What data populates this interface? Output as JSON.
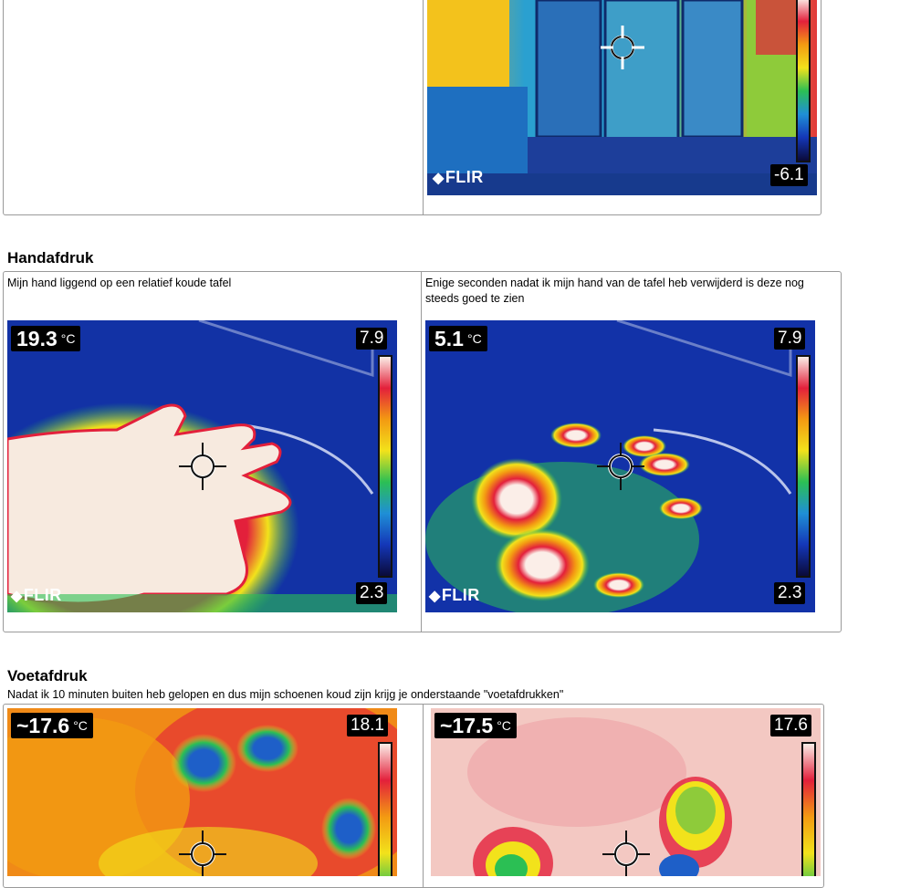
{
  "top_image": {
    "scale_min": "-6.1",
    "logo": "FLIR"
  },
  "hand": {
    "title": "Handafdruk",
    "left_caption": "Mijn hand liggend op een relatief koude tafel",
    "right_caption": "Enige seconden nadat ik mijn hand van de tafel heb verwijderd is deze nog steeds goed te zien",
    "left_image": {
      "temp": "19.3",
      "unit": "°C",
      "scale_max": "7.9",
      "scale_min": "2.3",
      "logo": "FLIR"
    },
    "right_image": {
      "temp": "5.1",
      "unit": "°C",
      "scale_max": "7.9",
      "scale_min": "2.3",
      "logo": "FLIR"
    }
  },
  "foot": {
    "title": "Voetafdruk",
    "caption": "Nadat ik 10 minuten buiten heb gelopen en dus mijn schoenen koud zijn krijg je onderstaande \"voetafdrukken\"",
    "left_image": {
      "temp": "~17.6",
      "unit": "°C",
      "scale_max": "18.1"
    },
    "right_image": {
      "temp": "~17.5",
      "unit": "°C",
      "scale_max": "17.6"
    }
  },
  "colors": {
    "border": "#9a9a9a",
    "thermal_cold": "#1a2f9a",
    "thermal_hot": "#e3203b"
  }
}
